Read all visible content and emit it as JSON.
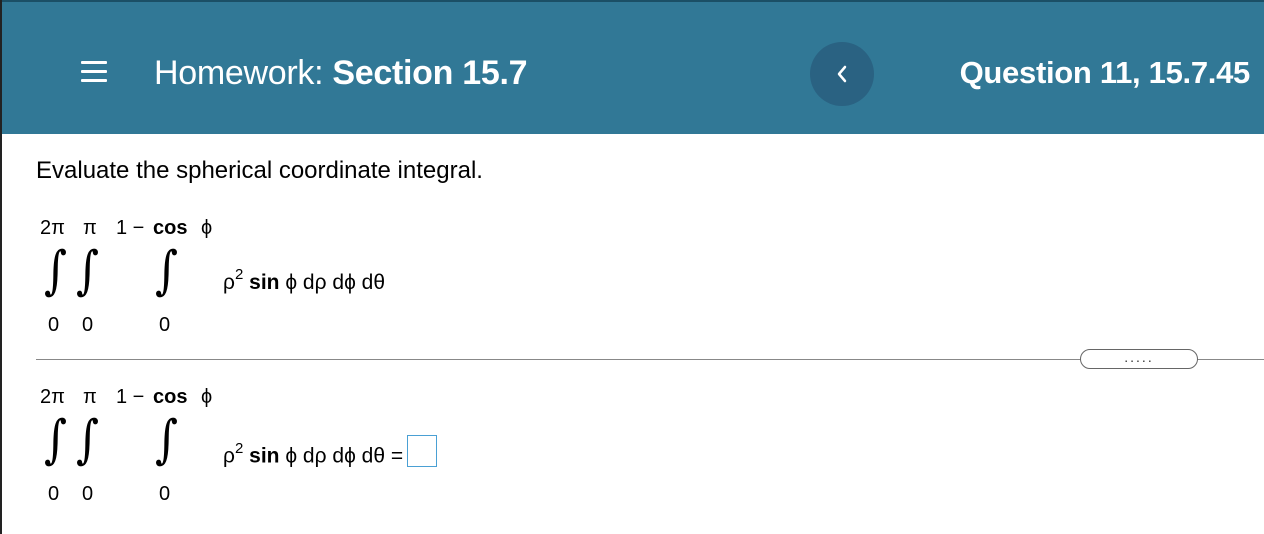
{
  "header": {
    "homework_label": "Homework:",
    "section_label": "Section 15.7",
    "question_label": "Question 11, 15.7.45",
    "back_icon": "chevron-left-icon",
    "menu_icon": "hamburger-menu-icon",
    "background_color": "#317896"
  },
  "problem": {
    "prompt": "Evaluate the spherical coordinate integral.",
    "integral": {
      "upper_limits": [
        "2π",
        "π",
        "1 −",
        "cos",
        "ϕ"
      ],
      "lower_limits": [
        "0",
        "0",
        "0"
      ],
      "integrand_rho": "ρ",
      "integrand_exp": "2",
      "integrand_sin": "sin",
      "integrand_rest": "ϕ dρ dϕ dθ"
    }
  },
  "answer": {
    "upper_limits": [
      "2π",
      "π",
      "1 −",
      "cos",
      "ϕ"
    ],
    "lower_limits": [
      "0",
      "0",
      "0"
    ],
    "integrand_rho": "ρ",
    "integrand_exp": "2",
    "integrand_sin": "sin",
    "integrand_rest": "ϕ dρ dϕ dθ =",
    "value": ""
  },
  "more_button_label": "....."
}
